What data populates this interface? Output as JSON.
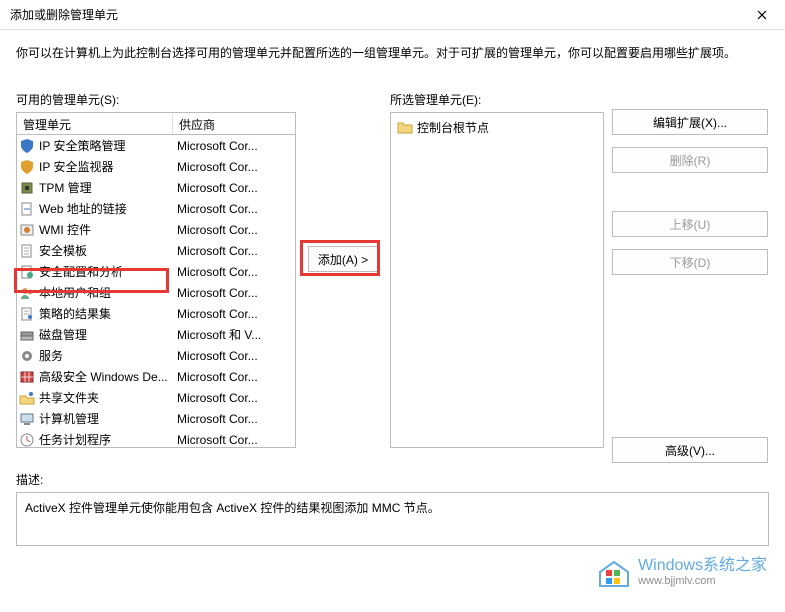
{
  "window": {
    "title": "添加或删除管理单元",
    "intro": "你可以在计算机上为此控制台选择可用的管理单元并配置所选的一组管理单元。对于可扩展的管理单元，你可以配置要启用哪些扩展项。"
  },
  "left": {
    "label": "可用的管理单元(S):",
    "col1": "管理单元",
    "col2": "供应商",
    "items": [
      {
        "icon": "shield-blue",
        "name": "IP 安全策略管理",
        "vendor": "Microsoft Cor..."
      },
      {
        "icon": "shield-yellow",
        "name": "IP 安全监视器",
        "vendor": "Microsoft Cor..."
      },
      {
        "icon": "chip",
        "name": "TPM 管理",
        "vendor": "Microsoft Cor..."
      },
      {
        "icon": "link-doc",
        "name": "Web 地址的链接",
        "vendor": "Microsoft Cor..."
      },
      {
        "icon": "wmi",
        "name": "WMI 控件",
        "vendor": "Microsoft Cor..."
      },
      {
        "icon": "template",
        "name": "安全模板",
        "vendor": "Microsoft Cor..."
      },
      {
        "icon": "config",
        "name": "安全配置和分析",
        "vendor": "Microsoft Cor..."
      },
      {
        "icon": "users",
        "name": "本地用户和组",
        "vendor": "Microsoft Cor...",
        "hl": true
      },
      {
        "icon": "policy",
        "name": "策略的结果集",
        "vendor": "Microsoft Cor..."
      },
      {
        "icon": "disk",
        "name": "磁盘管理",
        "vendor": "Microsoft 和 V..."
      },
      {
        "icon": "gear",
        "name": "服务",
        "vendor": "Microsoft Cor..."
      },
      {
        "icon": "firewall",
        "name": "高级安全 Windows De...",
        "vendor": "Microsoft Cor..."
      },
      {
        "icon": "share",
        "name": "共享文件夹",
        "vendor": "Microsoft Cor..."
      },
      {
        "icon": "pc",
        "name": "计算机管理",
        "vendor": "Microsoft Cor..."
      },
      {
        "icon": "task",
        "name": "任务计划程序",
        "vendor": "Microsoft Cor..."
      }
    ]
  },
  "mid": {
    "add": "添加(A) >"
  },
  "right": {
    "label": "所选管理单元(E):",
    "root": "控制台根节点"
  },
  "actions": {
    "editext": "编辑扩展(X)...",
    "remove": "删除(R)",
    "moveup": "上移(U)",
    "movedown": "下移(D)",
    "advanced": "高级(V)..."
  },
  "description": {
    "label": "描述:",
    "text": "ActiveX 控件管理单元使你能用包含 ActiveX 控件的结果视图添加 MMC 节点。"
  },
  "watermark": {
    "line1": "Windows系统之家",
    "line2": "www.bjjmlv.com"
  }
}
